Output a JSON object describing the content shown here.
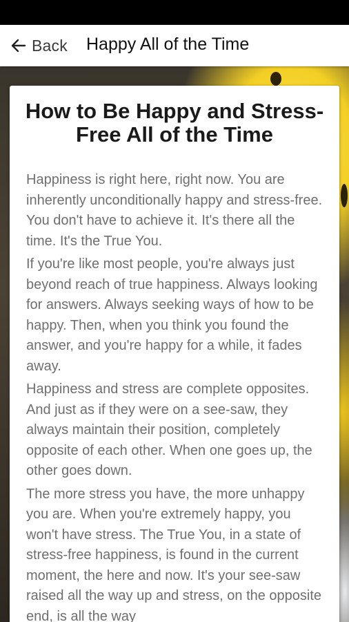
{
  "app_bar": {
    "back_label": "Back",
    "title": "Happy All of the Time"
  },
  "article": {
    "title": "How to Be Happy and Stress-Free All of the Time",
    "paragraphs": [
      "Happiness is right here, right now. You are inherently unconditionally happy and stress-free. You don't have to achieve it. It's there all the time. It's the True You.",
      "If you're like most people, you're always just beyond reach of true happiness. Always looking for answers. Always seeking ways of how to be happy. Then, when you think you found the answer, and you're happy for a while, it fades away.",
      "Happiness and stress are complete opposites. And just as if they were on a see-saw, they always maintain their position, completely opposite of each other. When one goes up, the other goes down.",
      "The more stress you have, the more unhappy you are. When you're extremely happy, you won't have stress. The True You, in a state of stress-free happiness, is found in the current moment, the here and now. It's your see-saw raised all the way up and stress, on the opposite end, is all the way"
    ]
  },
  "icons": {
    "back": "arrow-left-icon"
  },
  "colors": {
    "status_bar": "#000000",
    "app_bar": "#ffffff",
    "card": "#ffffff",
    "title_text": "#1a1a1a",
    "body_text": "#6f6f6f",
    "background_accent": "#f3cf25"
  }
}
